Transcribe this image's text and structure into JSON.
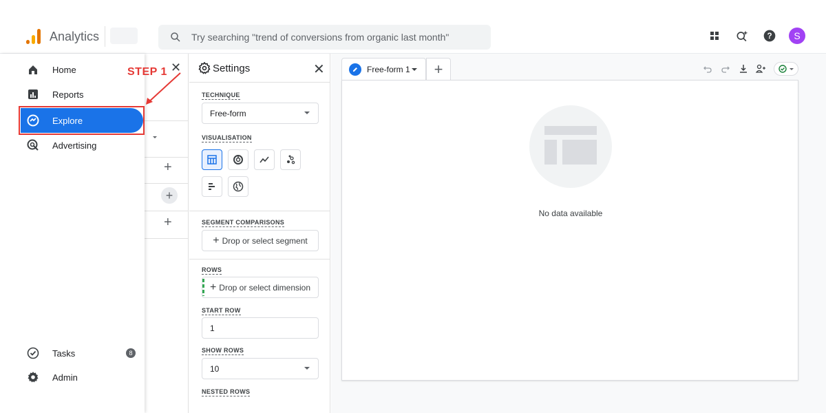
{
  "app": {
    "title": "Analytics"
  },
  "search": {
    "placeholder": "Try searching \"trend of conversions from organic last month\""
  },
  "user": {
    "avatar_letter": "S"
  },
  "nav": {
    "items": [
      {
        "label": "Home",
        "icon": "home-icon"
      },
      {
        "label": "Reports",
        "icon": "reports-icon"
      },
      {
        "label": "Explore",
        "icon": "explore-icon",
        "active": true
      },
      {
        "label": "Advertising",
        "icon": "advertising-icon"
      }
    ],
    "bottom": [
      {
        "label": "Tasks",
        "icon": "tasks-icon",
        "badge": "8"
      },
      {
        "label": "Admin",
        "icon": "admin-gear-icon"
      }
    ]
  },
  "annotation": {
    "step_label": "STEP 1",
    "color": "#e53935"
  },
  "settings": {
    "title": "Settings",
    "technique_label": "TECHNIQUE",
    "technique_value": "Free-form",
    "visualisation_label": "VISUALISATION",
    "segment_label": "SEGMENT COMPARISONS",
    "segment_drop": "Drop or select segment",
    "rows_label": "ROWS",
    "rows_drop": "Drop or select dimension",
    "start_row_label": "START ROW",
    "start_row_value": "1",
    "show_rows_label": "SHOW ROWS",
    "show_rows_value": "10",
    "nested_rows_label": "NESTED ROWS"
  },
  "canvas": {
    "tab_label": "Free-form 1",
    "empty_message": "No data available"
  },
  "colors": {
    "accent": "#1a73e8",
    "logo_orange": "#e37400",
    "logo_yellow": "#f9ab00",
    "avatar": "#a142f4",
    "highlight": "#e53935"
  }
}
